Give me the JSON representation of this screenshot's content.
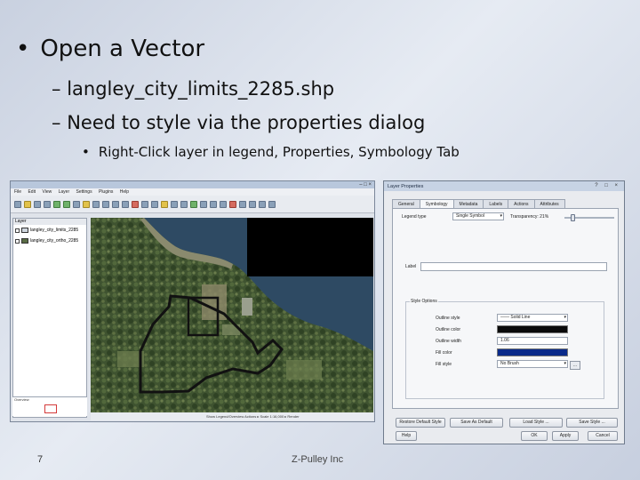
{
  "slide": {
    "bullet1": "Open a Vector",
    "bullet2a": "langley_city_limits_2285.shp",
    "bullet2b": "Need to style via the properties dialog",
    "bullet3": "Right-Click layer in legend, Properties, Symbology Tab",
    "dash": "–",
    "dot": "•",
    "number": "7",
    "footer": "Z-Pulley Inc"
  },
  "qgis": {
    "menu": [
      "File",
      "Edit",
      "View",
      "Layer",
      "Settings",
      "Plugins",
      "Help"
    ],
    "legend_header": "Layer",
    "layers": [
      {
        "label": "langley_city_limits_2285",
        "color": "#cfd6de"
      },
      {
        "label": "langley_city_ortho_2285",
        "color": "#5a6d45"
      }
    ],
    "overview_header": "Overview",
    "status_text": "Show Legend/Overview Actions ▸ Scale 1:16,000 ▸ Render"
  },
  "dialog": {
    "title": "Layer Properties",
    "window_buttons": "? □ ×",
    "tabs": [
      "General",
      "Symbology",
      "Metadata",
      "Labels",
      "Actions",
      "Attributes"
    ],
    "active_tab": "Symbology",
    "legend_type_label": "Legend type",
    "legend_type_value": "Single Symbol",
    "transparency_label": "Transparency: 21%",
    "label_label": "Label",
    "style_options_label": "Style Options",
    "outline_style_label": "Outline style",
    "outline_style_value": "—— Solid Line",
    "outline_color_label": "Outline color",
    "outline_color": "#0a0a0a",
    "outline_width_label": "Outline width",
    "outline_width_value": "1.06",
    "fill_color_label": "Fill color",
    "fill_color": "#0a2a8a",
    "fill_style_label": "Fill style",
    "fill_style_value": "No Brush",
    "more_button": "...",
    "buttons": {
      "restore": "Restore Default Style",
      "save_default": "Save As Default",
      "load": "Load Style ...",
      "save_style": "Save Style ...",
      "help": "Help",
      "ok": "OK",
      "apply": "Apply",
      "cancel": "Cancel"
    }
  }
}
